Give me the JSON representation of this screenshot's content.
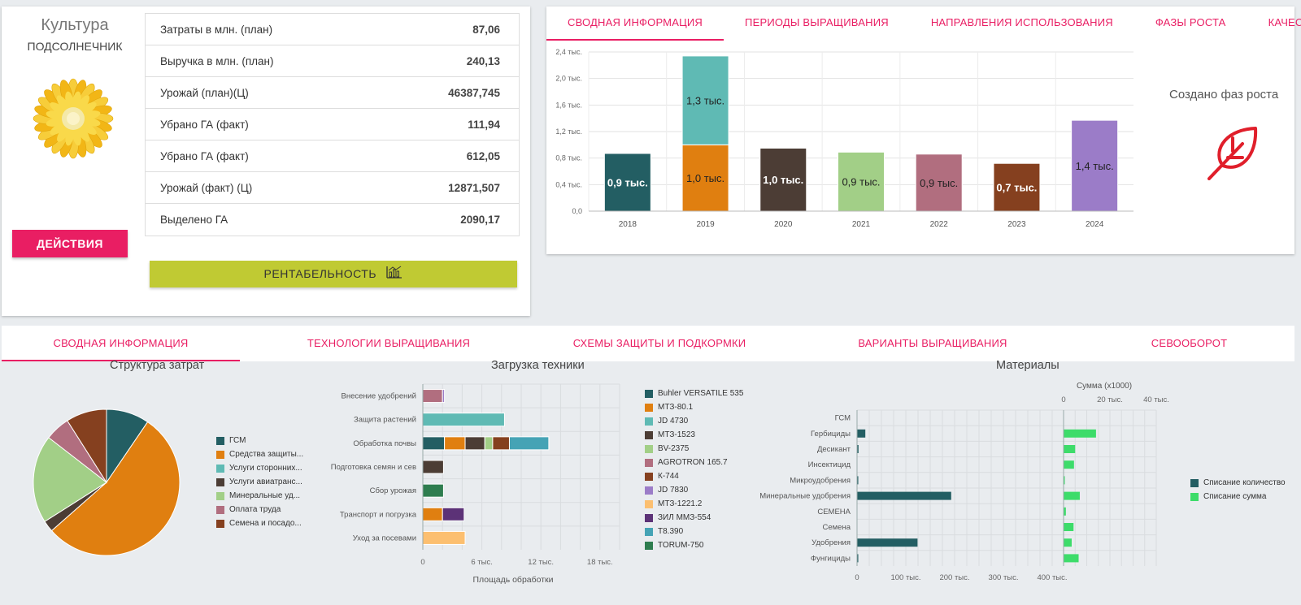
{
  "culture": {
    "title": "Культура",
    "name": "ПОДСОЛНЕЧНИК",
    "actions_label": "ДЕЙСТВИЯ",
    "profit_label": "РЕНТАБЕЛЬНОСТЬ",
    "stats": [
      {
        "label": "Затраты в млн. (план)",
        "value": "87,06"
      },
      {
        "label": "Выручка в млн. (план)",
        "value": "240,13"
      },
      {
        "label": "Урожай (план)(Ц)",
        "value": "46387,745"
      },
      {
        "label": "Убрано ГА (факт)",
        "value": "111,94"
      },
      {
        "label": "Убрано ГА (факт)",
        "value": "612,05"
      },
      {
        "label": "Урожай (факт) (Ц)",
        "value": "12871,507"
      },
      {
        "label": "Выделено ГА",
        "value": "2090,17"
      }
    ]
  },
  "growth": {
    "tabs": [
      {
        "label": "СВОДНАЯ ИНФОРМАЦИЯ",
        "active": true
      },
      {
        "label": "ПЕРИОДЫ ВЫРАЩИВАНИЯ",
        "active": false
      },
      {
        "label": "НАПРАВЛЕНИЯ ИСПОЛЬЗОВАНИЯ",
        "active": false
      },
      {
        "label": "ФАЗЫ РОСТА",
        "active": false
      },
      {
        "label": "КАЧЕСТВО",
        "active": false
      }
    ],
    "phase_label": "Создано фаз роста",
    "accent": "#e91e63"
  },
  "bottom": {
    "tabs": [
      {
        "label": "СВОДНАЯ ИНФОРМАЦИЯ",
        "active": true
      },
      {
        "label": "ТЕХНОЛОГИИ ВЫРАЩИВАНИЯ",
        "active": false
      },
      {
        "label": "СХЕМЫ ЗАЩИТЫ И ПОДКОРМКИ",
        "active": false
      },
      {
        "label": "ВАРИАНТЫ ВЫРАЩИВАНИЯ",
        "active": false
      },
      {
        "label": "СЕВООБОРОТ",
        "active": false
      }
    ]
  },
  "chart_data": [
    {
      "type": "bar",
      "categories": [
        "2018",
        "2019",
        "2020",
        "2021",
        "2022",
        "2023",
        "2024"
      ],
      "stacks": [
        [
          {
            "value": 0.87,
            "label": "0,9 тыс.",
            "color": "#235e63"
          }
        ],
        [
          {
            "value": 1.0,
            "label": "1,0 тыс.",
            "color": "#e07f10"
          },
          {
            "value": 1.34,
            "label": "1,3 тыс.",
            "color": "#5fbab4"
          }
        ],
        [
          {
            "value": 0.95,
            "label": "1,0 тыс.",
            "color": "#4c3d35"
          }
        ],
        [
          {
            "value": 0.89,
            "label": "0,9 тыс.",
            "color": "#a2cf87"
          }
        ],
        [
          {
            "value": 0.86,
            "label": "0,9 тыс.",
            "color": "#b16e7f"
          }
        ],
        [
          {
            "value": 0.72,
            "label": "0,7 тыс.",
            "color": "#85401f"
          }
        ],
        [
          {
            "value": 1.37,
            "label": "1,4 тыс.",
            "color": "#9b7cc8"
          }
        ]
      ],
      "ylim": [
        0,
        2.4
      ],
      "yticks": [
        "0,0",
        "0,4 тыс.",
        "0,8 тыс.",
        "1,2 тыс.",
        "1,6 тыс.",
        "2,0 тыс.",
        "2,4 тыс."
      ],
      "grid": true
    },
    {
      "type": "pie",
      "title": "Структура затрат",
      "slices": [
        {
          "name": "ГСМ",
          "value": 0.095,
          "color": "#235e63"
        },
        {
          "name": "Средства защиты...",
          "value": 0.54,
          "color": "#e07f10"
        },
        {
          "name": "Услуги сторонних...",
          "value": 0.0,
          "color": "#5fbab4"
        },
        {
          "name": "Услуги авиатранс...",
          "value": 0.025,
          "color": "#4c3d35"
        },
        {
          "name": "Минеральные уд...",
          "value": 0.195,
          "color": "#a2cf87"
        },
        {
          "name": "Оплата труда",
          "value": 0.055,
          "color": "#b16e7f"
        },
        {
          "name": "Семена и посадо...",
          "value": 0.09,
          "color": "#85401f"
        }
      ],
      "legend": "right"
    },
    {
      "type": "bar",
      "orientation": "horizontal",
      "stacked": true,
      "title": "Загрузка техники",
      "xlabel": "Площадь обработки",
      "xticks": [
        "0",
        "6 тыс.",
        "12 тыс.",
        "18 тыс."
      ],
      "xlim": [
        0,
        20000
      ],
      "categories": [
        "Внесение удобрений",
        "Защита растений",
        "Обработка почвы",
        "Подготовка семян и сев",
        "Сбор урожая",
        "Транспорт и погрузка",
        "Уход за посевами"
      ],
      "series": [
        {
          "name": "Buhler VERSATILE 535",
          "color": "#235e63",
          "values": [
            0,
            0,
            2200,
            0,
            0,
            0,
            0
          ]
        },
        {
          "name": "МТЗ-80.1",
          "color": "#e07f10",
          "values": [
            0,
            0,
            2100,
            0,
            0,
            2000,
            0
          ]
        },
        {
          "name": "JD 4730",
          "color": "#5fbab4",
          "values": [
            0,
            8300,
            0,
            0,
            0,
            0,
            0
          ]
        },
        {
          "name": "МТЗ-1523",
          "color": "#4c3d35",
          "values": [
            0,
            0,
            2000,
            2100,
            0,
            0,
            0
          ]
        },
        {
          "name": "BV-2375",
          "color": "#a2cf87",
          "values": [
            0,
            0,
            800,
            0,
            0,
            0,
            0
          ]
        },
        {
          "name": "AGROTRON 165.7",
          "color": "#b16e7f",
          "values": [
            2000,
            0,
            0,
            0,
            0,
            0,
            0
          ]
        },
        {
          "name": "К-744",
          "color": "#85401f",
          "values": [
            0,
            0,
            1700,
            0,
            0,
            0,
            0
          ]
        },
        {
          "name": "JD 7830",
          "color": "#9b7cc8",
          "values": [
            200,
            0,
            0,
            0,
            0,
            0,
            0
          ]
        },
        {
          "name": "МТЗ-1221.2",
          "color": "#fcbf70",
          "values": [
            0,
            0,
            0,
            0,
            0,
            0,
            4300
          ]
        },
        {
          "name": "ЗИЛ ММЗ-554",
          "color": "#5c3277",
          "values": [
            0,
            0,
            0,
            0,
            0,
            2200,
            0
          ]
        },
        {
          "name": "T8.390",
          "color": "#45a3b5",
          "values": [
            0,
            0,
            4000,
            0,
            0,
            0,
            0
          ]
        },
        {
          "name": "TORUM-750",
          "color": "#2e7d4f",
          "values": [
            0,
            0,
            0,
            0,
            2100,
            0,
            0
          ]
        }
      ],
      "legend": "right"
    },
    {
      "type": "bar",
      "orientation": "horizontal",
      "title": "Материалы",
      "categories": [
        "ГСМ",
        "Гербициды",
        "Десикант",
        "Инсектицид",
        "Микроудобрения",
        "Минеральные удобрения",
        "СЕМЕНА",
        "Семена",
        "Удобрения",
        "Фунгициды"
      ],
      "series": [
        {
          "name": "Списание количество",
          "color": "#235e63",
          "xlim": [
            0,
            400000
          ],
          "xticks": [
            "0",
            "100 тыс.",
            "200 тыс.",
            "300 тыс.",
            "400 тыс."
          ],
          "values": [
            0,
            17000,
            3000,
            0,
            500,
            193000,
            0,
            0,
            124000,
            1500
          ]
        },
        {
          "name": "Списание сумма",
          "color": "#3ddc6a",
          "xlabel": "Сумма (x1000)",
          "xlim": [
            0,
            40
          ],
          "xticks": [
            "0",
            "20 тыс.",
            "40 тыс."
          ],
          "values": [
            0,
            14,
            5,
            4.5,
            0.3,
            7,
            1,
            4.3,
            3.5,
            6.5
          ]
        }
      ],
      "legend": "right"
    }
  ]
}
